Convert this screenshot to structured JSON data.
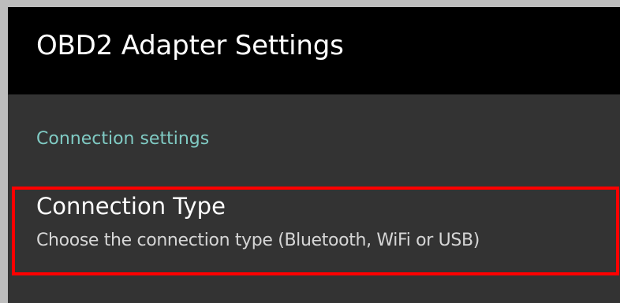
{
  "toolbar": {
    "title": "OBD2 Adapter Settings"
  },
  "category": {
    "title": "Connection settings",
    "accent_color": "#80cbc4"
  },
  "preferences": [
    {
      "title": "Connection Type",
      "summary": "Choose the connection type (Bluetooth, WiFi or USB)",
      "highlighted": true,
      "highlight_color": "#ff0000"
    }
  ]
}
